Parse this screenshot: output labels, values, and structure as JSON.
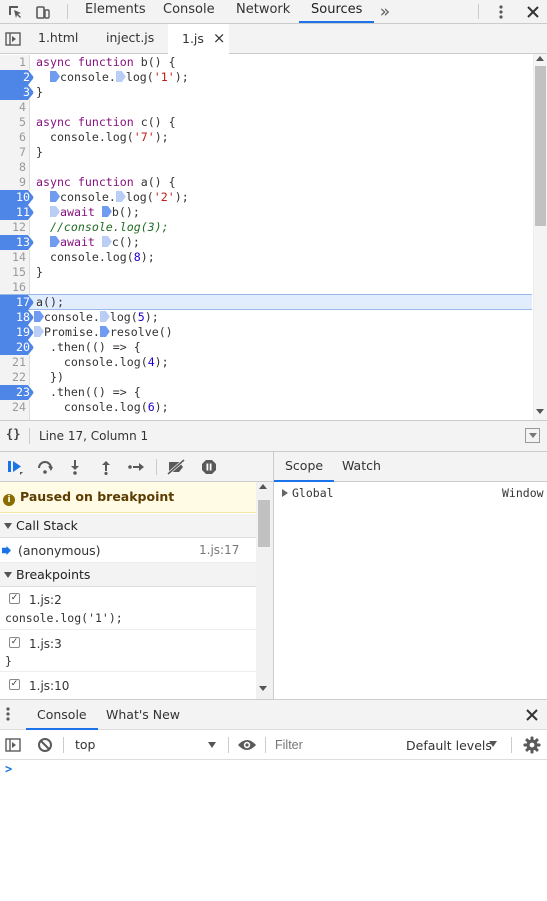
{
  "main_tabs": [
    "Elements",
    "Console",
    "Network",
    "Sources"
  ],
  "more_tabs": "»",
  "file_tabs": [
    "1.html",
    "inject.js",
    "1.js"
  ],
  "close_glyph": "×",
  "code": {
    "l1": {
      "n": "1",
      "a": "async function",
      "b": " b() {"
    },
    "l2": {
      "n": "2",
      "a": "console.",
      "b": "log(",
      "s": "'1'",
      "c": ");"
    },
    "l3": {
      "n": "3",
      "a": "}"
    },
    "l4": {
      "n": "4"
    },
    "l5": {
      "n": "5",
      "a": "async function",
      "b": " c() {"
    },
    "l6": {
      "n": "6",
      "a": "  console.log(",
      "s": "'7'",
      "c": ");"
    },
    "l7": {
      "n": "7",
      "a": "}"
    },
    "l8": {
      "n": "8"
    },
    "l9": {
      "n": "9",
      "a": "async function",
      "b": " a() {"
    },
    "l10": {
      "n": "10",
      "a": "console.",
      "b": "log(",
      "s": "'2'",
      "c": ");"
    },
    "l11": {
      "n": "11",
      "k": "await",
      "b": "b();"
    },
    "l12": {
      "n": "12",
      "cm": "  //console.log(3);"
    },
    "l13": {
      "n": "13",
      "k": "await",
      "b": "c();"
    },
    "l14": {
      "n": "14",
      "a": "  console.log(",
      "num": "8",
      "c": ");"
    },
    "l15": {
      "n": "15",
      "a": "}"
    },
    "l16": {
      "n": "16"
    },
    "l17": {
      "n": "17",
      "a": "a();"
    },
    "l18": {
      "n": "18",
      "a": "console.",
      "b": "log(",
      "num": "5",
      "c": ");"
    },
    "l19": {
      "n": "19",
      "a": "Promise.",
      "b": "resolve()"
    },
    "l20": {
      "n": "20",
      "a": "  .then(() => {"
    },
    "l21": {
      "n": "21",
      "a": "    console.log(",
      "num": "4",
      "c": ");"
    },
    "l22": {
      "n": "22",
      "a": "  })"
    },
    "l23": {
      "n": "23",
      "a": "  .then(() => {"
    },
    "l24": {
      "n": "24",
      "a": "    console.log(",
      "num": "6",
      "c": ");"
    }
  },
  "status_bar": {
    "braces": "{}",
    "position": "Line 17, Column 1"
  },
  "debugger": {
    "paused_text": "Paused on breakpoint",
    "call_stack_label": "Call Stack",
    "call_frame": {
      "name": "(anonymous)",
      "location": "1.js:17"
    },
    "breakpoints_label": "Breakpoints",
    "breakpoints": [
      {
        "location": "1.js:2",
        "snippet": "console.log('1');"
      },
      {
        "location": "1.js:3",
        "snippet": "}"
      },
      {
        "location": "1.js:10",
        "snippet": ""
      }
    ]
  },
  "scope": {
    "tabs": [
      "Scope",
      "Watch"
    ],
    "global_label": "Global",
    "global_value": "Window"
  },
  "console": {
    "tabs": [
      "Console",
      "What's New"
    ],
    "context": "top",
    "filter_placeholder": "Filter",
    "levels": "Default levels",
    "prompt": ">"
  },
  "colors": {
    "accent": "#1a73e8",
    "breakpoint": "#4e86e8",
    "paused_bg": "#fffbe5"
  }
}
